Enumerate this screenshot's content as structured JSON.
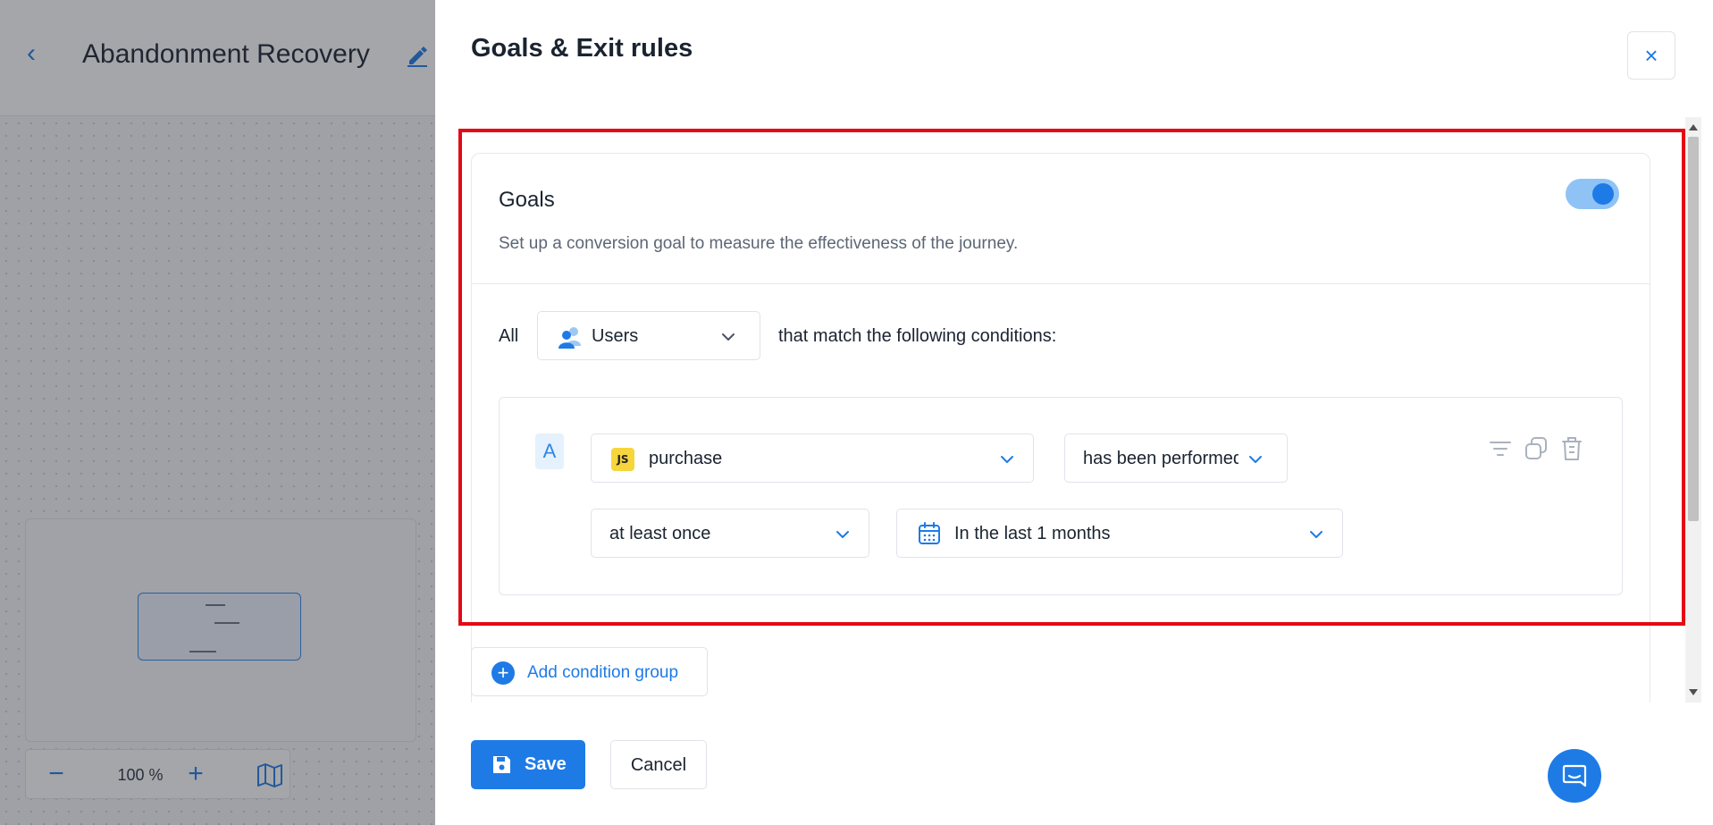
{
  "background": {
    "page_title": "Abandonment Recovery",
    "zoom_level": "100 %",
    "zoom_minus": "−",
    "zoom_plus": "+",
    "back_glyph": "‹"
  },
  "drawer": {
    "title": "Goals & Exit rules",
    "close_glyph": "×",
    "goals": {
      "title": "Goals",
      "description": "Set up a conversion goal to measure the effectiveness of the journey.",
      "enabled": true,
      "all_label": "All",
      "audience": "Users",
      "match_text": "that match the following conditions:",
      "group": {
        "letter": "A",
        "event_badge": "JS",
        "event": "purchase",
        "operator": "has been performed",
        "frequency": "at least once",
        "time_range": "In the last 1 months"
      },
      "add_group_label": "Add condition group",
      "add_group_glyph": "+"
    },
    "save_label": "Save",
    "cancel_label": "Cancel"
  },
  "colors": {
    "accent": "#1e7be6",
    "highlight": "#e50914",
    "toggle_track": "#8fc3f6"
  },
  "icons": [
    "back-icon",
    "edit-icon",
    "map-icon",
    "close-icon",
    "users-icon",
    "chevron-down-icon",
    "calendar-icon",
    "filter-icon",
    "copy-icon",
    "trash-icon",
    "plus-circle-icon",
    "save-icon",
    "chat-icon"
  ]
}
